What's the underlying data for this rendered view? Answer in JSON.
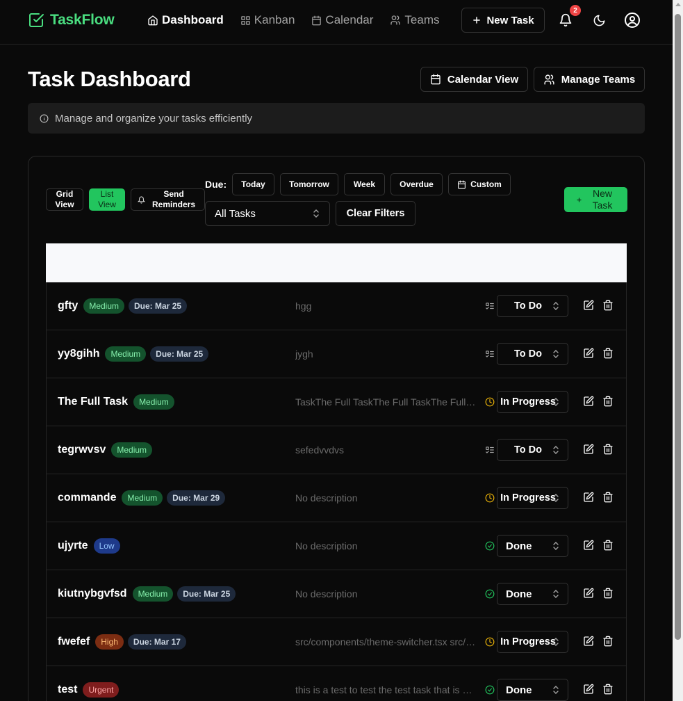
{
  "app": {
    "name": "TaskFlow"
  },
  "nav": {
    "links": [
      {
        "label": "Dashboard",
        "icon": "home-icon",
        "active": true
      },
      {
        "label": "Kanban",
        "icon": "grid-icon",
        "active": false
      },
      {
        "label": "Calendar",
        "icon": "calendar-icon",
        "active": false
      },
      {
        "label": "Teams",
        "icon": "users-icon",
        "active": false
      }
    ],
    "new_task_label": "New Task",
    "notification_count": "2"
  },
  "header": {
    "title": "Task Dashboard",
    "calendar_view_label": "Calendar View",
    "manage_teams_label": "Manage Teams",
    "info_text": "Manage and organize your tasks efficiently"
  },
  "toolbar": {
    "grid_view_label": "Grid View",
    "list_view_label": "List View",
    "send_reminders_label": "Send Reminders",
    "due_label": "Due:",
    "due_filters": [
      "Today",
      "Tomorrow",
      "Week",
      "Overdue"
    ],
    "custom_label": "Custom",
    "task_filter_selected": "All Tasks",
    "clear_filters_label": "Clear Filters",
    "new_task_label": "New Task"
  },
  "colors": {
    "accent": "#22c55e",
    "brand": "#4ade80",
    "background": "#0a0a0a",
    "in_progress": "#eab308",
    "done": "#22c55e",
    "todo": "#a3a3a3"
  },
  "tasks": [
    {
      "name": "gfty",
      "priority": "Medium",
      "priority_class": "medium",
      "due": "Due: Mar 25",
      "description": "hgg",
      "status": "To Do",
      "status_icon": "list-todo-icon"
    },
    {
      "name": "yy8gihh",
      "priority": "Medium",
      "priority_class": "medium",
      "due": "Due: Mar 25",
      "description": "jygh",
      "status": "To Do",
      "status_icon": "list-todo-icon"
    },
    {
      "name": "The Full Task",
      "priority": "Medium",
      "priority_class": "medium",
      "due": "",
      "description": "TaskThe Full TaskThe Full TaskThe Full Task",
      "status": "In Progress",
      "status_icon": "clock-icon"
    },
    {
      "name": "tegrwvsv",
      "priority": "Medium",
      "priority_class": "medium",
      "due": "",
      "description": "sefedvvdvs",
      "status": "To Do",
      "status_icon": "list-todo-icon"
    },
    {
      "name": "commande",
      "priority": "Medium",
      "priority_class": "medium",
      "due": "Due: Mar 29",
      "description": "No description",
      "status": "In Progress",
      "status_icon": "clock-icon"
    },
    {
      "name": "ujyrte",
      "priority": "Low",
      "priority_class": "low",
      "due": "",
      "description": "No description",
      "status": "Done",
      "status_icon": "check-circle-icon"
    },
    {
      "name": "kiutnybgvfsd",
      "priority": "Medium",
      "priority_class": "medium",
      "due": "Due: Mar 25",
      "description": "No description",
      "status": "Done",
      "status_icon": "check-circle-icon"
    },
    {
      "name": "fwefef",
      "priority": "High",
      "priority_class": "high",
      "due": "Due: Mar 17",
      "description": "src/components/theme-switcher.tsx src/components/theme-switcher.tsx",
      "status": "In Progress",
      "status_icon": "clock-icon"
    },
    {
      "name": "test",
      "priority": "Urgent",
      "priority_class": "urgent",
      "due": "",
      "description": "this is a test to test the test task that is a test",
      "status": "Done",
      "status_icon": "check-circle-icon"
    }
  ]
}
